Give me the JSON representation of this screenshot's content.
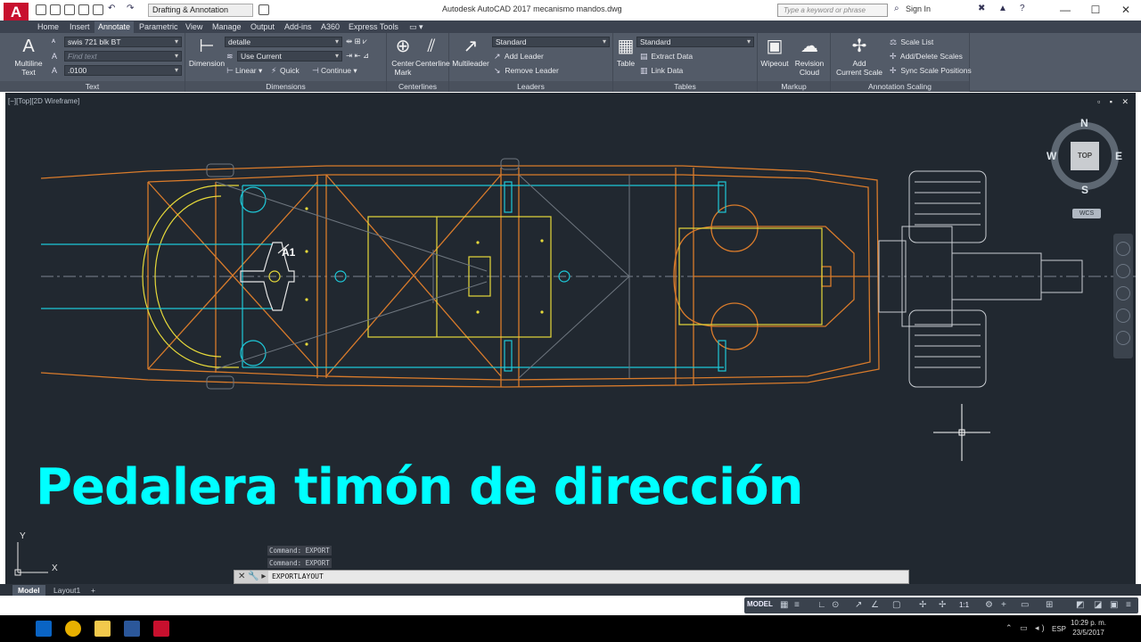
{
  "titlebar": {
    "app_logo": "A",
    "workspace": "Drafting & Annotation",
    "title": "Autodesk AutoCAD 2017    mecanismo mandos.dwg",
    "search_placeholder": "Type a keyword or phrase",
    "signin": "Sign In",
    "minimize": "—",
    "maximize": "☐",
    "close": "✕"
  },
  "ribbon_tabs": [
    "Home",
    "Insert",
    "Annotate",
    "Parametric",
    "View",
    "Manage",
    "Output",
    "Add-ins",
    "A360",
    "Express Tools"
  ],
  "ribbon": {
    "text_panel": {
      "title": "Text",
      "multiline_label": "Multiline\nText",
      "style": "swis 721 blk BT",
      "find_placeholder": "Find text",
      "height": ".0100"
    },
    "dimensions_panel": {
      "title": "Dimensions",
      "dimension_label": "Dimension",
      "dim_style": "detalle",
      "layer": "Use Current",
      "linear": "Linear",
      "quick": "Quick",
      "continue": "Continue"
    },
    "centerlines_panel": {
      "title": "Centerlines",
      "center_mark": "Center\nMark",
      "centerline": "Centerline"
    },
    "leaders_panel": {
      "title": "Leaders",
      "multileader": "Multileader",
      "style": "Standard",
      "add_leader": "Add Leader",
      "remove_leader": "Remove Leader"
    },
    "tables_panel": {
      "title": "Tables",
      "table": "Table",
      "style": "Standard",
      "extract_data": "Extract Data",
      "link_data": "Link Data"
    },
    "markup_panel": {
      "title": "Markup",
      "wipeout": "Wipeout",
      "revision_cloud": "Revision\nCloud"
    },
    "annotation_scaling_panel": {
      "title": "Annotation Scaling",
      "add_current_scale": "Add\nCurrent Scale",
      "scale_list": "Scale List",
      "add_delete_scales": "Add/Delete Scales",
      "sync_scale_positions": "Sync Scale Positions"
    }
  },
  "viewport": {
    "label": "[−][Top][2D Wireframe]",
    "controls": "▫ ▪ ✕",
    "big_title": "Pedalera timón de dirección",
    "callout": "A1",
    "compass": {
      "n": "N",
      "s": "S",
      "e": "E",
      "w": "W",
      "top": "TOP"
    },
    "wcs": "WCS",
    "ucs_x": "X",
    "ucs_y": "Y"
  },
  "command": {
    "history": [
      "Command: EXPORT",
      "Command: EXPORT"
    ],
    "input": "EXPORTLAYOUT",
    "prompt_icons": "✕ 🔧 ▸"
  },
  "layout_tabs": [
    "Model",
    "Layout1",
    "+"
  ],
  "status": {
    "model": "MODEL",
    "scale": "1:1"
  },
  "taskbar": {
    "lang": "ESP",
    "time": "10:29 p. m.",
    "date": "23/5/2017"
  },
  "colors": {
    "drawing_bg": "#212830",
    "orange": "#d97b2b",
    "yellow": "#e6d93a",
    "cyan": "#1ec8d8",
    "white_lines": "#e6e6e6",
    "title_cyan": "#00ffff"
  }
}
